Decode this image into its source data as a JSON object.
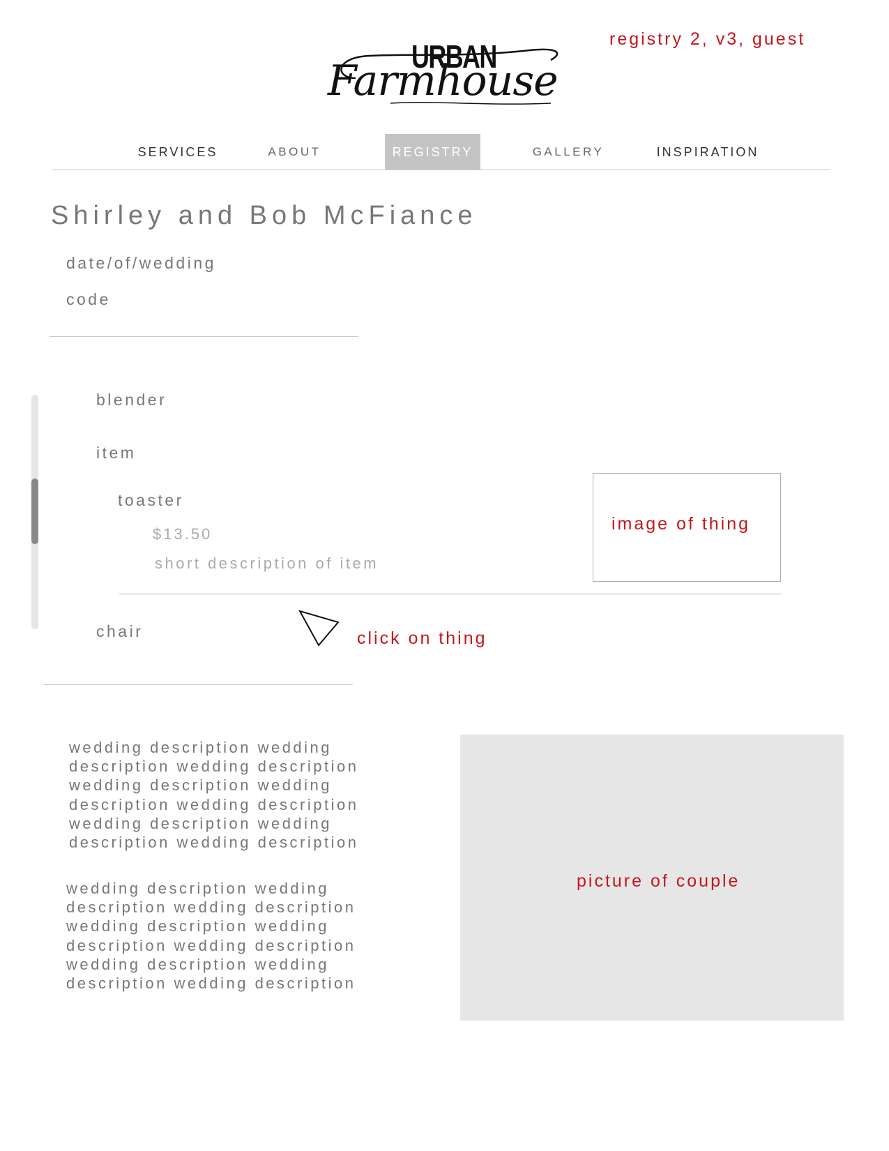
{
  "annotations": {
    "page_label": "registry 2, v3, guest",
    "image_placeholder": "image of thing",
    "click_hint": "click on thing",
    "couple_placeholder": "picture of couple"
  },
  "brand": {
    "logo_top": "URBAN",
    "logo_bottom": "Farmhouse"
  },
  "nav": {
    "items": [
      {
        "label": "SERVICES",
        "active": false
      },
      {
        "label": "ABOUT",
        "active": false
      },
      {
        "label": "REGISTRY",
        "active": true
      },
      {
        "label": "GALLERY",
        "active": false
      },
      {
        "label": "INSPIRATION",
        "active": false
      }
    ]
  },
  "registry": {
    "couple_name": "Shirley and Bob McFiance",
    "date": "date/of/wedding",
    "code": "code",
    "items": {
      "first": "blender",
      "second": "item",
      "expanded": {
        "name": "toaster",
        "price": "$13.50",
        "description": "short description of item"
      },
      "last": "chair"
    }
  },
  "description": {
    "block1": [
      "wedding description wedding",
      "description wedding description",
      "wedding description wedding",
      "description wedding description",
      "wedding description wedding",
      "description wedding description"
    ],
    "block2": [
      "wedding description wedding",
      "description wedding description",
      "wedding description wedding",
      "description wedding description",
      "wedding description wedding",
      "description wedding description"
    ]
  },
  "colors": {
    "annotation": "#c4161c",
    "active_tab": "#c4c4c4",
    "placeholder_fill": "#e6e6e6"
  }
}
